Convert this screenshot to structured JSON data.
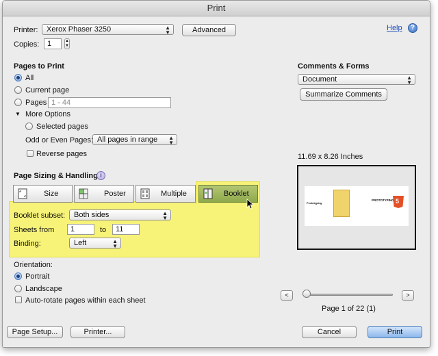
{
  "window": {
    "title": "Print"
  },
  "printer": {
    "label": "Printer:",
    "value": "Xerox Phaser 3250",
    "advanced_label": "Advanced"
  },
  "help": {
    "label": "Help"
  },
  "copies": {
    "label": "Copies:",
    "value": "1"
  },
  "pages_to_print": {
    "heading": "Pages to Print",
    "all_label": "All",
    "current_label": "Current page",
    "pages_label": "Pages",
    "pages_placeholder": "1 - 44",
    "more_options_label": "More Options",
    "selected_pages_label": "Selected pages",
    "odd_even_label": "Odd or Even Pages:",
    "odd_even_value": "All pages in range",
    "reverse_label": "Reverse pages",
    "selected": "All"
  },
  "comments_forms": {
    "heading": "Comments & Forms",
    "value": "Document",
    "summarize_label": "Summarize Comments"
  },
  "page_sizing": {
    "heading": "Page Sizing & Handling",
    "tabs": [
      {
        "label": "Size"
      },
      {
        "label": "Poster"
      },
      {
        "label": "Multiple"
      },
      {
        "label": "Booklet"
      }
    ],
    "active_tab": "Booklet"
  },
  "booklet": {
    "subset_label": "Booklet subset:",
    "subset_value": "Both sides",
    "sheets_from_label": "Sheets from",
    "sheets_from_value": "1",
    "to_label": "to",
    "sheets_to_value": "11",
    "binding_label": "Binding:",
    "binding_value": "Left"
  },
  "orientation": {
    "heading": "Orientation:",
    "portrait_label": "Portrait",
    "landscape_label": "Landscape",
    "auto_rotate_label": "Auto-rotate pages within each sheet",
    "selected": "Portrait"
  },
  "preview": {
    "size_label": "11.69 x 8.26 Inches",
    "left_text": "PROTOTYPING",
    "right_text": "PROTOTYPING",
    "page_status": "Page 1 of 22 (1)",
    "slider_fraction": 0.0
  },
  "footer": {
    "page_setup_label": "Page Setup...",
    "printer_label": "Printer...",
    "cancel_label": "Cancel",
    "print_label": "Print"
  },
  "colors": {
    "highlight": "#f7f378",
    "active_tab": "#9bb25a",
    "link": "#1f4fb8",
    "print_button": "#8cb7ec"
  }
}
